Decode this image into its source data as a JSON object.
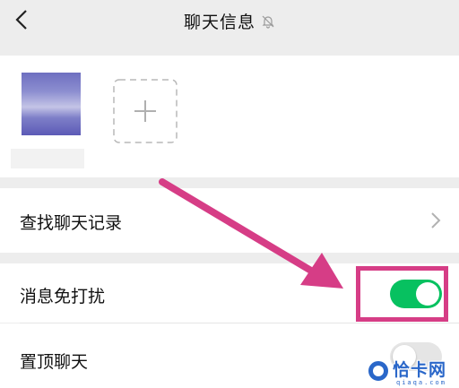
{
  "header": {
    "title": "聊天信息",
    "back_icon": "chevron-left-icon",
    "mute_icon": "bell-muted-icon"
  },
  "members": {
    "add_icon": "plus-icon"
  },
  "settings": {
    "search_history_label": "查找聊天记录",
    "do_not_disturb_label": "消息免打扰",
    "do_not_disturb_on": true,
    "pin_chat_label": "置顶聊天",
    "pin_chat_on": false
  },
  "colors": {
    "toggle_on": "#07c160",
    "toggle_off": "#e5e5e5",
    "annotation": "#d63d86",
    "background": "#ededed"
  },
  "watermark": {
    "text": "恰卡网",
    "sub": "qiaqa.com"
  }
}
